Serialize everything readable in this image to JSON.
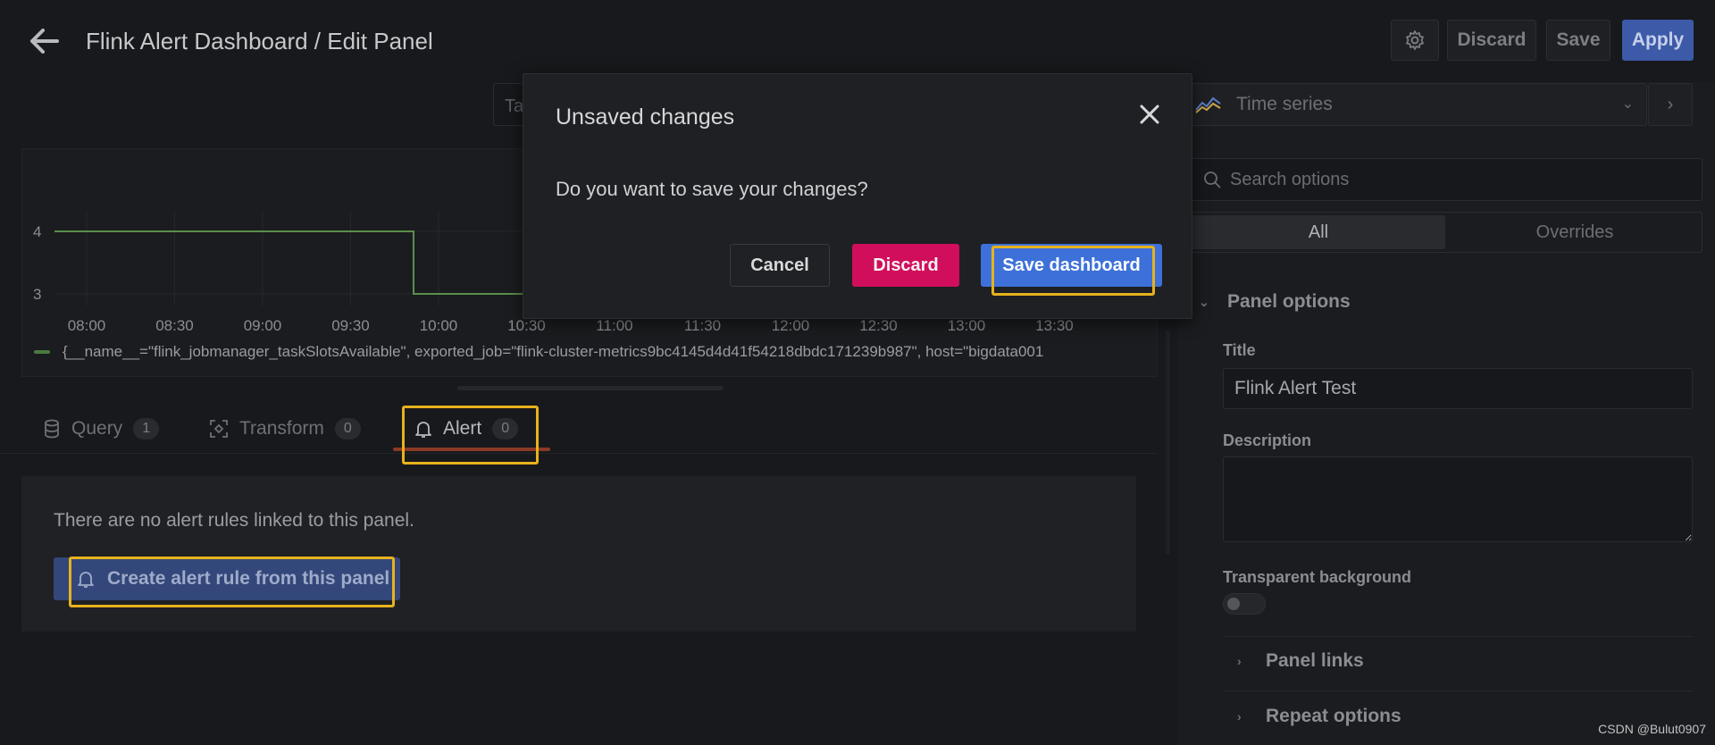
{
  "header": {
    "title": "Flink Alert Dashboard / Edit Panel",
    "discard_label": "Discard",
    "save_label": "Save",
    "apply_label": "Apply"
  },
  "table_toggle": {
    "label": "Ta"
  },
  "graph": {
    "y_ticks": [
      "4",
      "3"
    ],
    "x_ticks": [
      "08:00",
      "08:30",
      "09:00",
      "09:30",
      "10:00",
      "10:30",
      "11:00",
      "11:30",
      "12:00",
      "12:30",
      "13:00",
      "13:30"
    ],
    "legend": "{__name__=\"flink_jobmanager_taskSlotsAvailable\", exported_job=\"flink-cluster-metrics9bc4145d4d41f54218dbdc171239b987\", host=\"bigdata001",
    "series_color": "#5a8f4c"
  },
  "tabs": [
    {
      "label": "Query",
      "count": "1",
      "icon": "database-icon"
    },
    {
      "label": "Transform",
      "count": "0",
      "icon": "transform-icon"
    },
    {
      "label": "Alert",
      "count": "0",
      "icon": "bell-icon"
    }
  ],
  "alert_panel": {
    "message": "There are no alert rules linked to this panel.",
    "create_button": "Create alert rule from this panel"
  },
  "options_pane": {
    "viz_label": "Time series",
    "search_placeholder": "Search options",
    "seg_all": "All",
    "seg_overrides": "Overrides",
    "panel_options": "Panel options",
    "title_label": "Title",
    "title_value": "Flink Alert Test",
    "description_label": "Description",
    "transparent_label": "Transparent background",
    "transparent_on": false,
    "panel_links": "Panel links",
    "repeat_options": "Repeat options"
  },
  "modal": {
    "title": "Unsaved changes",
    "message": "Do you want to save your changes?",
    "cancel": "Cancel",
    "discard": "Discard",
    "save": "Save dashboard"
  },
  "watermark": "CSDN @Bulut0907",
  "colors": {
    "highlight": "#e8b21c",
    "primary": "#3d71d9",
    "destructive": "#d10e5c"
  }
}
